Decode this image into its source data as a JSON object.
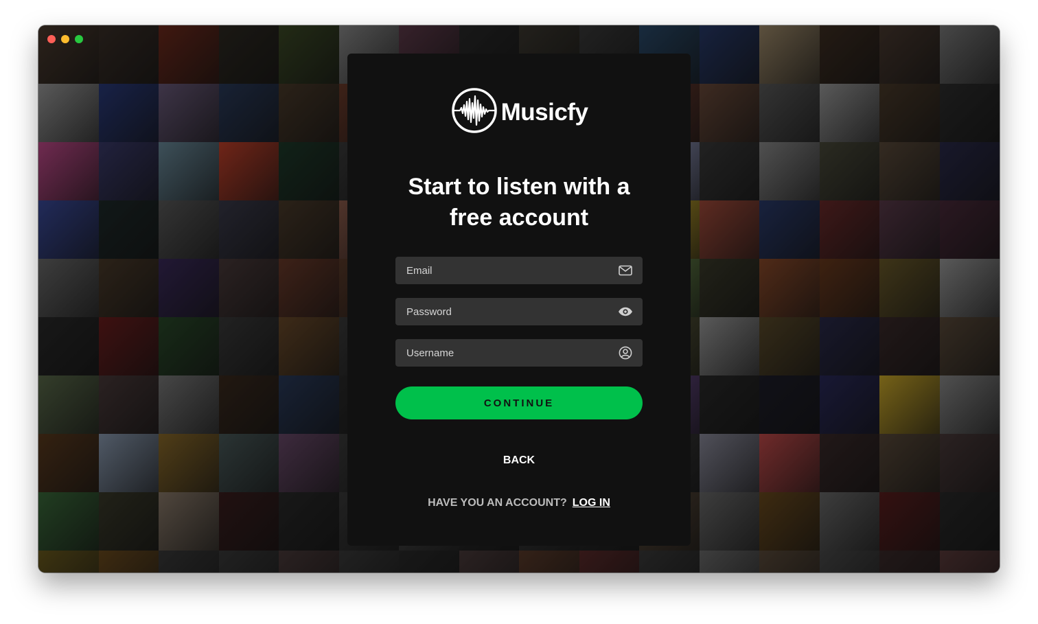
{
  "window": {
    "controls": [
      "close",
      "minimize",
      "maximize"
    ]
  },
  "background": {
    "tile_colors": [
      "#4a3a2e",
      "#3a2f28",
      "#6e2a1c",
      "#2e2a22",
      "#3c4a26",
      "#8a8a8a",
      "#5e3a4a",
      "#2a2a2a",
      "#3c3830",
      "#3a3a3a",
      "#2a4a6a",
      "#283a6a",
      "#9e8a6a",
      "#3e2e22",
      "#4a3a30",
      "#7a7a7a",
      "#9a9a9a",
      "#2a3a7a",
      "#6a5a7a",
      "#2a3a5a",
      "#4a3a2a",
      "#6a3a2a",
      "#1e1e1e",
      "#2a2a3a",
      "#4a4a3a",
      "#7a4a6a",
      "#6a3a2e",
      "#6a4a3a",
      "#5a5a5a",
      "#9a9a9a",
      "#4a3a2a",
      "#2e2e2e",
      "#c04a8a",
      "#3a3a6a",
      "#6a8a9a",
      "#c0402a",
      "#1e3a2a",
      "#3a3a3a",
      "#4a2a2a",
      "#3a5a8a",
      "#1e1e1e",
      "#6a3a2a",
      "#9aa0c8",
      "#3a3a3a",
      "#8a8a8a",
      "#4a4a3a",
      "#5a4a3a",
      "#2a2a4a",
      "#3a4a9a",
      "#1e2a2a",
      "#5a5a5a",
      "#3a3a4a",
      "#4a3a2a",
      "#8a5a4a",
      "#2a2a2a",
      "#5a2a2a",
      "#3a3a3a",
      "#5a4a3a",
      "#caaa2a",
      "#a04a3a",
      "#2a3a6a",
      "#6a2a2a",
      "#5a3a4a",
      "#4a2a3a",
      "#6a6a6a",
      "#4a3a2a",
      "#3a2a5a",
      "#4a3a3a",
      "#6a3a2a",
      "#5a3a2a",
      "#3a2a2a",
      "#2a2a2a",
      "#2a3a4a",
      "#4a3a2a",
      "#6a8a4a",
      "#3a3a2a",
      "#8a4a2a",
      "#6a3a1e",
      "#6a5a2a",
      "#9a9a9a",
      "#2a2a2a",
      "#6a1e1e",
      "#2a4a2a",
      "#3a3a3a",
      "#6a4a2a",
      "#3a3a3a",
      "#3a2a2a",
      "#4a4a4a",
      "#3a2a1e",
      "#3a3a3a",
      "#5a5a3a",
      "#9a9a9a",
      "#5a4a2a",
      "#2a2a4a",
      "#3a2a2a",
      "#5a4a3a",
      "#5a6a4a",
      "#4a3a3a",
      "#7a7a7a",
      "#3a2a1e",
      "#2a3a5a",
      "#2a2a2a",
      "#3a3a2a",
      "#4a3a3a",
      "#3a3a3a",
      "#2a2a2a",
      "#6a4a8a",
      "#2a2a2a",
      "#1e1e2a",
      "#2a2a5a",
      "#caa82a",
      "#8a8a8a",
      "#5a3a1e",
      "#8a9ab0",
      "#8a6a2a",
      "#4a5a5a",
      "#6a4a6a",
      "#3a3a3a",
      "#2a2a2a",
      "#5a5a5a",
      "#6a4a3a",
      "#3a3a3a",
      "#3a3a3a",
      "#8a8a9a",
      "#c04a4a",
      "#3a2a2a",
      "#5a4a3a",
      "#4a3a3a",
      "#3a6a3a",
      "#3a3a2a",
      "#8a7a6a",
      "#3a1e1e",
      "#2a2a2a",
      "#3a3a3a",
      "#4a4a4a",
      "#2a2a2a",
      "#3a3a3a",
      "#2a2a2a",
      "#5a4a3a",
      "#6a6a6a",
      "#6a4a1e",
      "#6a6a6a",
      "#5a1e1e",
      "#2a2a2a",
      "#6a5a1e",
      "#6a4a1e",
      "#3a3a3a",
      "#3a3a3a",
      "#4a3a3a",
      "#3a3a3a",
      "#2a2a2a",
      "#4a3a3a",
      "#5a3a2a",
      "#5a2a2a",
      "#3a3a3a",
      "#6a6a6a",
      "#5a4a3a",
      "#4a4a4a",
      "#3a2a2a",
      "#5a3a3a"
    ]
  },
  "brand": {
    "name": "Musicfy",
    "logo_icon": "soundwave-circle-icon",
    "accent": "#00c04b"
  },
  "heading": {
    "line1": "Start to listen with a",
    "line2": "free account"
  },
  "form": {
    "email_placeholder": "Email",
    "email_icon": "envelope-icon",
    "password_placeholder": "Password",
    "password_icon": "eye-icon",
    "username_placeholder": "Username",
    "username_icon": "user-circle-icon",
    "continue_label": "CONTINUE"
  },
  "links": {
    "back_label": "BACK",
    "account_question": "HAVE YOU AN ACCOUNT?",
    "login_label": "LOG IN"
  }
}
